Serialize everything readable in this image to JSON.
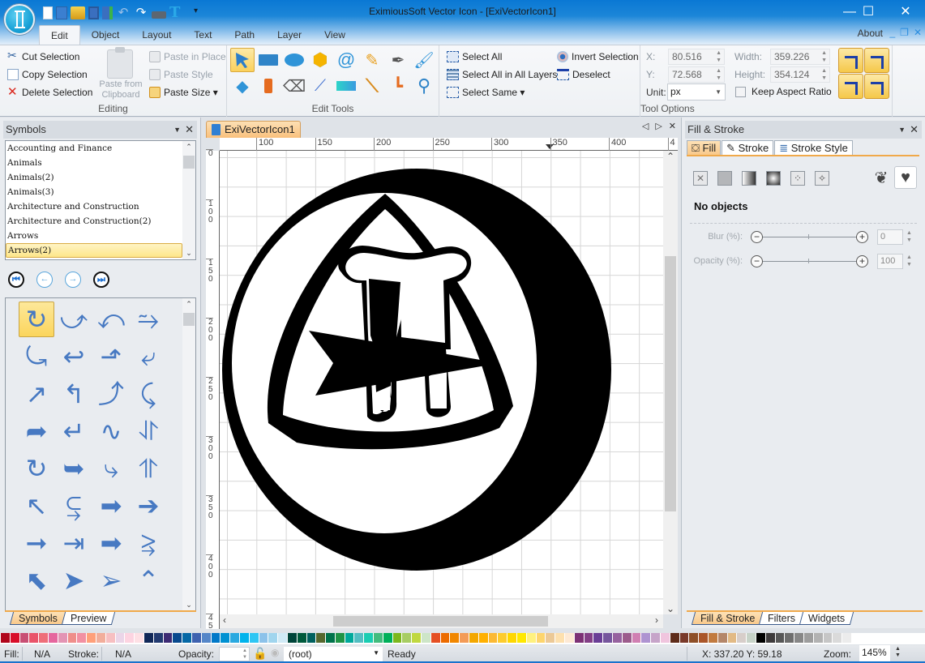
{
  "window": {
    "title": "EximiousSoft Vector Icon - [ExiVectorIcon1]",
    "minimize": "—",
    "maximize": "☐",
    "close": "✕"
  },
  "quick_access": [
    "new-icon",
    "template-icon",
    "open-icon",
    "save-icon",
    "save-as-icon",
    "undo-icon",
    "redo-icon",
    "print-icon",
    "text-icon",
    "customize-icon"
  ],
  "ribbon_tabs": [
    {
      "label": "Edit",
      "active": true
    },
    {
      "label": "Object"
    },
    {
      "label": "Layout"
    },
    {
      "label": "Text"
    },
    {
      "label": "Path"
    },
    {
      "label": "Layer"
    },
    {
      "label": "View"
    }
  ],
  "about_label": "About",
  "editing_group": {
    "label": "Editing",
    "cut": "Cut Selection",
    "copy": "Copy Selection",
    "delete": "Delete Selection",
    "paste_from_clipboard": "Paste from Clipboard",
    "paste_in_place": "Paste in Place",
    "paste_style": "Paste Style",
    "paste_size": "Paste Size ▾"
  },
  "edit_tools_group": {
    "label": "Edit Tools",
    "tools_row1": [
      "select-tool",
      "rectangle-tool",
      "ellipse-tool",
      "star-polygon-tool",
      "spiral-tool",
      "pencil-tool",
      "pen-tool",
      "calligraphy-tool"
    ],
    "tools_row2": [
      "node-tool",
      "spray-tool",
      "eraser-tool",
      "dropper-tool",
      "gradient-tool",
      "tweak-tool",
      "connector-tool",
      "zoom-tool"
    ]
  },
  "selection_group": {
    "select_all": "Select All",
    "select_all_layers": "Select All in All Layers",
    "select_same": "Select Same ▾",
    "invert_selection": "Invert Selection",
    "deselect": "Deselect"
  },
  "tool_options": {
    "label": "Tool Options",
    "x_label": "X:",
    "x_value": "80.516",
    "y_label": "Y:",
    "y_value": "72.568",
    "width_label": "Width:",
    "width_value": "359.226",
    "height_label": "Height:",
    "height_value": "354.124",
    "unit_label": "Unit:",
    "unit_value": "px",
    "keep_aspect": "Keep Aspect Ratio",
    "keep_aspect_checked": false
  },
  "symbols_panel": {
    "title": "Symbols",
    "categories": [
      "Accounting and Finance",
      "Animals",
      "Animals(2)",
      "Animals(3)",
      "Architecture and Construction",
      "Architecture and Construction(2)",
      "Arrows",
      "Arrows(2)"
    ],
    "selected_category": "Arrows(2)",
    "nav": [
      "first-icon",
      "prev-icon",
      "next-icon",
      "last-icon"
    ],
    "nav_glyphs": [
      "⏮",
      "←",
      "→",
      "⏭"
    ],
    "symbols": [
      "↻",
      "⤻",
      "⤺",
      "⥲",
      "⤿",
      "↩",
      "⬏",
      "⤶",
      "↗",
      "↰",
      "⤴",
      "⤹",
      "➦",
      "↵",
      "∿",
      "⥯",
      "↻",
      "➥",
      "⤷",
      "⥣",
      "↖",
      "⥹",
      "➡",
      "➔",
      "➞",
      "⇥",
      "➡",
      "⥸",
      "⬉",
      "➤",
      "➢",
      "⌃"
    ],
    "tabs": [
      "Symbols",
      "Preview"
    ]
  },
  "document": {
    "tab_label": "ExiVectorIcon1",
    "ruler_h": [
      "100",
      "150",
      "200",
      "250",
      "300",
      "350",
      "400",
      "4"
    ],
    "ruler_v": [
      "0",
      "100",
      "150",
      "200",
      "250",
      "300",
      "350",
      "400",
      "45"
    ]
  },
  "fill_stroke_panel": {
    "title": "Fill & Stroke",
    "tabs": [
      "Fill",
      "Stroke",
      "Stroke Style"
    ],
    "fill_types": [
      "no-paint-icon",
      "flat-color-icon",
      "linear-gradient-icon",
      "radial-gradient-icon",
      "pattern-icon",
      "swatch-icon"
    ],
    "no_objects": "No objects",
    "blur_label": "Blur (%):",
    "blur_value": "0",
    "opacity_label": "Opacity (%):",
    "opacity_value": "100",
    "bottom_tabs": [
      "Fill & Stroke",
      "Filters",
      "Widgets"
    ]
  },
  "palette": [
    "#b0061c",
    "#d80f2a",
    "#c84f74",
    "#e9546a",
    "#ee6e79",
    "#e5669e",
    "#e394b4",
    "#ef8e8a",
    "#f290a2",
    "#ffa07a",
    "#f2ae9b",
    "#f7bfc1",
    "#ebd5e8",
    "#fdd4e1",
    "#fee0e5",
    "#112858",
    "#223a70",
    "#3d2b74",
    "#08498e",
    "#0568a6",
    "#3e62b0",
    "#5586c8",
    "#0078c8",
    "#0091d2",
    "#2aa9e0",
    "#00b3ec",
    "#2ec6f4",
    "#8cc2ea",
    "#a0d5ee",
    "#d0eaf6",
    "#00453a",
    "#005a3c",
    "#00615f",
    "#56682e",
    "#00734b",
    "#1f9446",
    "#00a99b",
    "#53bec2",
    "#1acdb2",
    "#42bc7e",
    "#00b05a",
    "#7db81d",
    "#a7cd63",
    "#c0d840",
    "#cde5c7",
    "#e55025",
    "#ec6b00",
    "#f18700",
    "#f39b57",
    "#f3a700",
    "#ffb000",
    "#fbb934",
    "#fdcc2d",
    "#fed700",
    "#ffe800",
    "#fff17e",
    "#fdd56d",
    "#ecc996",
    "#fde0ae",
    "#fde9d4",
    "#7c3175",
    "#833f86",
    "#6a3e96",
    "#76569d",
    "#96629f",
    "#9c5c8c",
    "#d07fb2",
    "#ae93d1",
    "#c6a4c9",
    "#f0c5de",
    "#5e2c1a",
    "#793a2a",
    "#8e4f27",
    "#aa5629",
    "#c17a3f",
    "#b48669",
    "#e2ba85",
    "#d7ceca",
    "#c7d3c8",
    "#000000",
    "#3e3b3c",
    "#575757",
    "#6e6e6e",
    "#878787",
    "#9d9d9d",
    "#b2b2b2",
    "#c6c6c6",
    "#dadada",
    "#ececec"
  ],
  "status": {
    "fill_label": "Fill:",
    "fill_value": "N/A",
    "stroke_label": "Stroke:",
    "stroke_value": "N/A",
    "opacity_label": "Opacity:",
    "opacity_value": "",
    "layer_value": "(root)",
    "state": "Ready",
    "coords": "X: 337.20 Y:   59.18",
    "zoom_label": "Zoom:",
    "zoom_value": "145%"
  }
}
